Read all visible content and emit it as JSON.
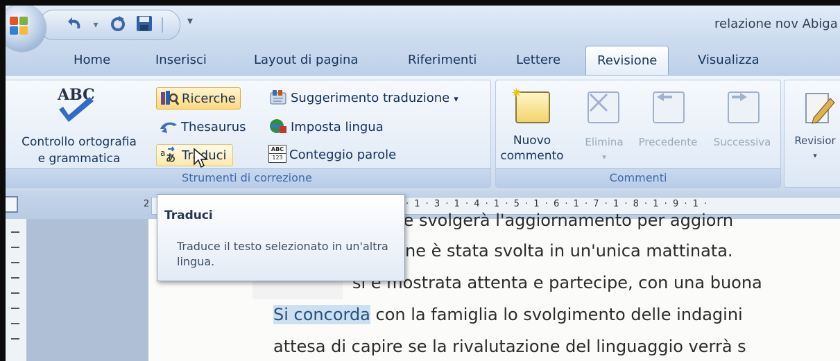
{
  "window": {
    "title": "relazione nov  Abiga"
  },
  "quick_access": {
    "undo_icon": "undo-icon",
    "redo_icon": "redo-icon",
    "save_icon": "save-icon",
    "customize_icon": "customize-qat-icon"
  },
  "tabs": [
    {
      "label": "Home"
    },
    {
      "label": "Inserisci"
    },
    {
      "label": "Layout di pagina"
    },
    {
      "label": "Riferimenti"
    },
    {
      "label": "Lettere"
    },
    {
      "label": "Revisione",
      "active": true
    },
    {
      "label": "Visualizza"
    }
  ],
  "ribbon": {
    "proofing": {
      "spelling": {
        "logo": "ABC",
        "line1": "Controllo ortografia",
        "line2": "e grammatica"
      },
      "ricerche": "Ricerche",
      "thesaurus": "Thesaurus",
      "traduci": "Traduci",
      "suggerimento": "Suggerimento traduzione",
      "imposta_lingua": "Imposta lingua",
      "conteggio": "Conteggio parole",
      "conteggio_icon_text": "ABC",
      "conteggio_icon_num": "123",
      "group_label": "Strumenti di correzione"
    },
    "comments": {
      "nuovo_line1": "Nuovo",
      "nuovo_line2": "commento",
      "elimina": "Elimina",
      "precedente": "Precedente",
      "successiva": "Successiva",
      "group_label": "Commenti"
    },
    "tracking": {
      "revisioni": "Revisior"
    }
  },
  "ruler": {
    "margin_mark": "2",
    "scale": "· 1 · 3 · 1 · 4 · 1 · 5 · 1 · 6 · 1 · 7 · 1 · 8 · 1 · 9 · 1 ·"
  },
  "tooltip": {
    "title": "Traduci",
    "description": "Traduce il testo selezionato in un'altra lingua."
  },
  "document": {
    "line1": "breve svolgerà l'aggiornamento per aggiorn",
    "line2": "ne è stata svolta in un'unica mattinata.",
    "line3": "si  è mostrata attenta e partecipe, con una buona",
    "line4_selected": "Si concorda",
    "line4_rest": " con la famiglia lo svolgimento delle indagini",
    "line5": "attesa di capire se la rivalutazione del linguaggio verrà s"
  },
  "colors": {
    "ribbon_bg": "#dde8f5",
    "active_tab": "#ffffff",
    "highlight": "#ffd97a",
    "selection": "#cce0f2",
    "group_label": "#3c6aa8"
  }
}
